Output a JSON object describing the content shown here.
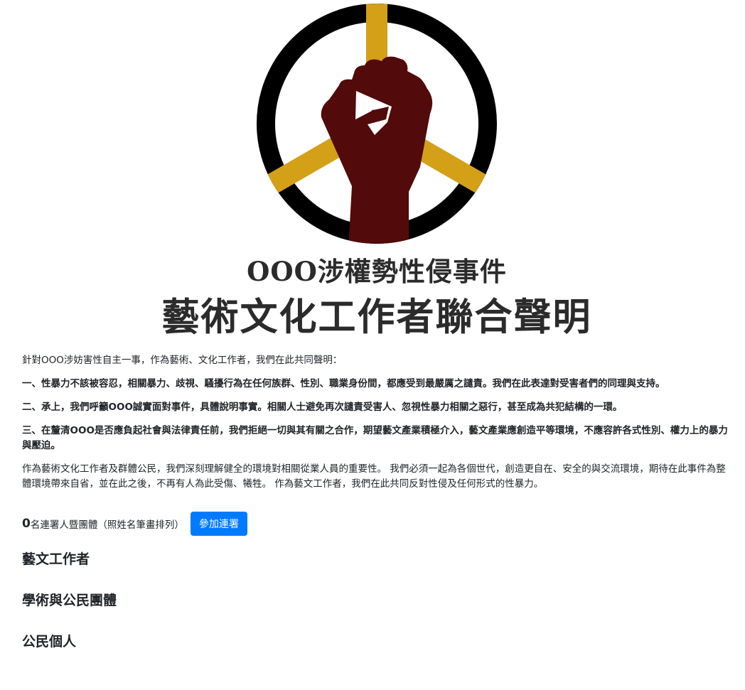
{
  "logo": {
    "colors": {
      "ring": "#000000",
      "spokes": "#d4a017",
      "fist": "#520a0a",
      "fist_highlight": "#ffffff"
    }
  },
  "title": {
    "line1": "OOO涉權勢性侵事件",
    "line2": "藝術文化工作者聯合聲明"
  },
  "statement": {
    "intro": "針對OOO涉妨害性自主一事，作為藝術、文化工作者，我們在此共同聲明：",
    "point1": "一、性暴力不該被容忍，相關暴力、歧視、騷擾行為在任何族群、性別、職業身份間，都應受到最嚴厲之譴責。我們在此表達對受害者們的同理與支持。",
    "point2": "二、承上，我們呼籲OOO誠實面對事件，具體說明事實。相關人士避免再次譴責受害人、忽視性暴力相關之惡行，甚至成為共犯結構的一環。",
    "point3": "三、在釐清OOO是否應負起社會與法律責任前，我們拒絕一切與其有關之合作，期望藝文產業積極介入，藝文產業應創造平等環境，不應容許各式性別、權力上的暴力與壓迫。",
    "closing": "作為藝術文化工作者及群體公民，我們深刻理解健全的環境對相關從業人員的重要性。 我們必須一起為各個世代，創造更自在、安全的與交流環境，期待在此事件為整體環境帶來自省，並在此之後，不再有人為此受傷、犧牲。 作為藝文工作者，我們在此共同反對性侵及任何形式的性暴力。"
  },
  "signatures": {
    "count": "0",
    "count_label": "名連署人暨團體（照姓名筆畫排列）",
    "button_label": "參加連署",
    "button_color": "#007bff"
  },
  "sections": {
    "artists": "藝文工作者",
    "academic": "學術與公民團體",
    "citizens": "公民個人"
  }
}
